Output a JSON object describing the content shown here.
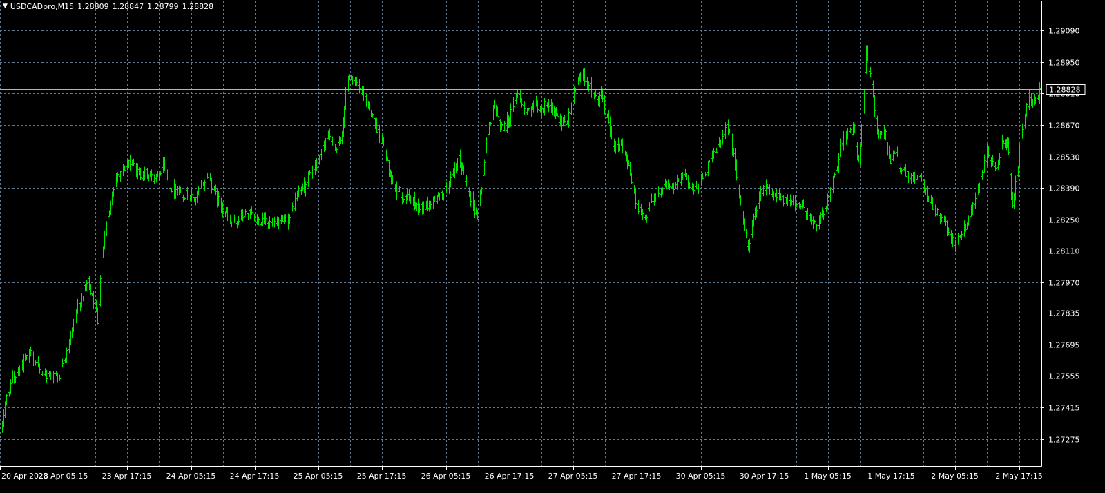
{
  "title": {
    "symbol_timeframe": "USDCADpro,M15",
    "open": "1.28809",
    "high": "1.28847",
    "low": "1.28799",
    "close": "1.28828",
    "collapse_icon": "triangle-down-icon"
  },
  "colors": {
    "background": "#000000",
    "grid": "#5f7890",
    "bars": "#00e600",
    "axis_text": "#ffffff",
    "price_line": "#a8b8c8",
    "price_label_bg": "#000000"
  },
  "chart_data": {
    "type": "bar",
    "style": "ohlc-bars",
    "symbol": "USDCADpro",
    "timeframe": "M15",
    "current_price": 1.28828,
    "current_price_label": "1.28828",
    "y_axis": {
      "position": "right",
      "ylim": [
        1.2721,
        1.2928
      ],
      "ticks": [
        1.2909,
        1.2895,
        1.2881,
        1.2867,
        1.2853,
        1.2839,
        1.2825,
        1.2811,
        1.2797,
        1.27835,
        1.27695,
        1.27555,
        1.27415,
        1.27275
      ],
      "tick_labels": [
        "1.29090",
        "1.28950",
        "1.28810",
        "1.28670",
        "1.28530",
        "1.28390",
        "1.28250",
        "1.28110",
        "1.27970",
        "1.27835",
        "1.27695",
        "1.27555",
        "1.27415",
        "1.27275"
      ]
    },
    "x_axis": {
      "tick_labels": [
        "20 Apr 2018",
        "23 Apr 05:15",
        "23 Apr 17:15",
        "24 Apr 05:15",
        "24 Apr 17:15",
        "25 Apr 05:15",
        "25 Apr 17:15",
        "26 Apr 05:15",
        "26 Apr 17:15",
        "27 Apr 05:15",
        "27 Apr 17:15",
        "30 Apr 05:15",
        "30 Apr 17:15",
        "1 May 05:15",
        "1 May 17:15",
        "2 May 05:15",
        "2 May 17:15"
      ],
      "bars_per_tick": 48,
      "bar_count": 776
    },
    "grid": true,
    "price_path": [
      [
        0,
        1.273
      ],
      [
        6,
        1.2744
      ],
      [
        14,
        1.2752
      ],
      [
        24,
        1.2758
      ],
      [
        34,
        1.2762
      ],
      [
        44,
        1.2766
      ],
      [
        48,
        1.2762
      ],
      [
        56,
        1.2758
      ],
      [
        66,
        1.2756
      ],
      [
        76,
        1.2756
      ],
      [
        84,
        1.2754
      ],
      [
        90,
        1.276
      ],
      [
        100,
        1.277
      ],
      [
        110,
        1.2785
      ],
      [
        120,
        1.2793
      ],
      [
        126,
        1.2798
      ],
      [
        134,
        1.279
      ],
      [
        140,
        1.278
      ],
      [
        146,
        1.281
      ],
      [
        152,
        1.2822
      ],
      [
        160,
        1.2832
      ],
      [
        168,
        1.2845
      ],
      [
        178,
        1.2848
      ],
      [
        190,
        1.285
      ],
      [
        200,
        1.2845
      ],
      [
        210,
        1.2846
      ],
      [
        220,
        1.2843
      ],
      [
        228,
        1.2846
      ],
      [
        236,
        1.285
      ],
      [
        244,
        1.284
      ],
      [
        256,
        1.2838
      ],
      [
        268,
        1.2836
      ],
      [
        280,
        1.2834
      ],
      [
        292,
        1.284
      ],
      [
        300,
        1.2845
      ],
      [
        312,
        1.2835
      ],
      [
        322,
        1.283
      ],
      [
        334,
        1.2822
      ],
      [
        346,
        1.2826
      ],
      [
        358,
        1.2828
      ],
      [
        370,
        1.2824
      ],
      [
        382,
        1.2826
      ],
      [
        394,
        1.2822
      ],
      [
        406,
        1.2823
      ],
      [
        418,
        1.2826
      ],
      [
        424,
        1.2832
      ],
      [
        432,
        1.2838
      ],
      [
        440,
        1.284
      ],
      [
        448,
        1.2846
      ],
      [
        456,
        1.2848
      ],
      [
        462,
        1.2852
      ],
      [
        468,
        1.2858
      ],
      [
        474,
        1.2862
      ],
      [
        480,
        1.286
      ],
      [
        486,
        1.2856
      ],
      [
        492,
        1.286
      ],
      [
        498,
        1.2875
      ],
      [
        504,
        1.289
      ],
      [
        510,
        1.2887
      ],
      [
        518,
        1.2883
      ],
      [
        526,
        1.288
      ],
      [
        534,
        1.2875
      ],
      [
        542,
        1.2868
      ],
      [
        548,
        1.2862
      ],
      [
        554,
        1.2858
      ],
      [
        560,
        1.285
      ],
      [
        566,
        1.284
      ],
      [
        574,
        1.2838
      ],
      [
        582,
        1.2836
      ],
      [
        590,
        1.2834
      ],
      [
        600,
        1.2832
      ],
      [
        610,
        1.283
      ],
      [
        620,
        1.2832
      ],
      [
        630,
        1.2834
      ],
      [
        640,
        1.2836
      ],
      [
        648,
        1.284
      ],
      [
        656,
        1.2845
      ],
      [
        662,
        1.2852
      ],
      [
        668,
        1.2848
      ],
      [
        676,
        1.284
      ],
      [
        684,
        1.2832
      ],
      [
        690,
        1.2826
      ],
      [
        696,
        1.284
      ],
      [
        702,
        1.2855
      ],
      [
        708,
        1.2868
      ],
      [
        714,
        1.2875
      ],
      [
        720,
        1.287
      ],
      [
        728,
        1.2865
      ],
      [
        736,
        1.287
      ],
      [
        744,
        1.2878
      ],
      [
        750,
        1.2882
      ],
      [
        758,
        1.2874
      ],
      [
        766,
        1.2872
      ],
      [
        774,
        1.2876
      ],
      [
        782,
        1.2872
      ],
      [
        790,
        1.2878
      ],
      [
        798,
        1.2874
      ],
      [
        806,
        1.287
      ],
      [
        814,
        1.2866
      ],
      [
        822,
        1.287
      ],
      [
        830,
        1.288
      ],
      [
        838,
        1.289
      ],
      [
        846,
        1.2888
      ],
      [
        852,
        1.2885
      ],
      [
        858,
        1.288
      ],
      [
        864,
        1.2878
      ],
      [
        870,
        1.288
      ],
      [
        878,
        1.287
      ],
      [
        886,
        1.286
      ],
      [
        894,
        1.2858
      ],
      [
        902,
        1.2855
      ],
      [
        910,
        1.285
      ],
      [
        916,
        1.2838
      ],
      [
        924,
        1.283
      ],
      [
        932,
        1.2825
      ],
      [
        940,
        1.2833
      ],
      [
        948,
        1.2836
      ],
      [
        956,
        1.2838
      ],
      [
        964,
        1.284
      ],
      [
        972,
        1.2838
      ],
      [
        980,
        1.2842
      ],
      [
        988,
        1.2845
      ],
      [
        996,
        1.2842
      ],
      [
        1004,
        1.2838
      ],
      [
        1012,
        1.284
      ],
      [
        1020,
        1.2846
      ],
      [
        1028,
        1.2852
      ],
      [
        1036,
        1.2855
      ],
      [
        1044,
        1.286
      ],
      [
        1052,
        1.2868
      ],
      [
        1058,
        1.286
      ],
      [
        1064,
        1.2848
      ],
      [
        1070,
        1.2835
      ],
      [
        1076,
        1.2822
      ],
      [
        1082,
        1.2812
      ],
      [
        1088,
        1.282
      ],
      [
        1094,
        1.283
      ],
      [
        1100,
        1.2838
      ],
      [
        1108,
        1.284
      ],
      [
        1116,
        1.2836
      ],
      [
        1124,
        1.2835
      ],
      [
        1132,
        1.2834
      ],
      [
        1140,
        1.2832
      ],
      [
        1148,
        1.2833
      ],
      [
        1156,
        1.2832
      ],
      [
        1164,
        1.283
      ],
      [
        1172,
        1.2826
      ],
      [
        1180,
        1.2822
      ],
      [
        1188,
        1.2825
      ],
      [
        1196,
        1.2832
      ],
      [
        1204,
        1.284
      ],
      [
        1212,
        1.285
      ],
      [
        1220,
        1.286
      ],
      [
        1228,
        1.2865
      ],
      [
        1236,
        1.2864
      ],
      [
        1242,
        1.285
      ],
      [
        1248,
        1.287
      ],
      [
        1254,
        1.2898
      ],
      [
        1260,
        1.289
      ],
      [
        1266,
        1.2875
      ],
      [
        1272,
        1.286
      ],
      [
        1278,
        1.2865
      ],
      [
        1284,
        1.286
      ],
      [
        1290,
        1.285
      ],
      [
        1296,
        1.2855
      ],
      [
        1302,
        1.2848
      ],
      [
        1310,
        1.2845
      ],
      [
        1318,
        1.2843
      ],
      [
        1326,
        1.2845
      ],
      [
        1334,
        1.2842
      ],
      [
        1342,
        1.2835
      ],
      [
        1350,
        1.283
      ],
      [
        1358,
        1.2828
      ],
      [
        1366,
        1.2825
      ],
      [
        1374,
        1.2818
      ],
      [
        1382,
        1.2815
      ],
      [
        1390,
        1.2818
      ],
      [
        1398,
        1.2822
      ],
      [
        1406,
        1.283
      ],
      [
        1414,
        1.2838
      ],
      [
        1422,
        1.2845
      ],
      [
        1430,
        1.2855
      ],
      [
        1436,
        1.285
      ],
      [
        1442,
        1.2845
      ],
      [
        1448,
        1.2855
      ],
      [
        1454,
        1.2862
      ],
      [
        1460,
        1.2856
      ],
      [
        1466,
        1.283
      ],
      [
        1472,
        1.2845
      ],
      [
        1478,
        1.2862
      ],
      [
        1484,
        1.2872
      ],
      [
        1490,
        1.288
      ],
      [
        1496,
        1.2876
      ],
      [
        1502,
        1.2878
      ],
      [
        1507,
        1.2883
      ]
    ]
  }
}
